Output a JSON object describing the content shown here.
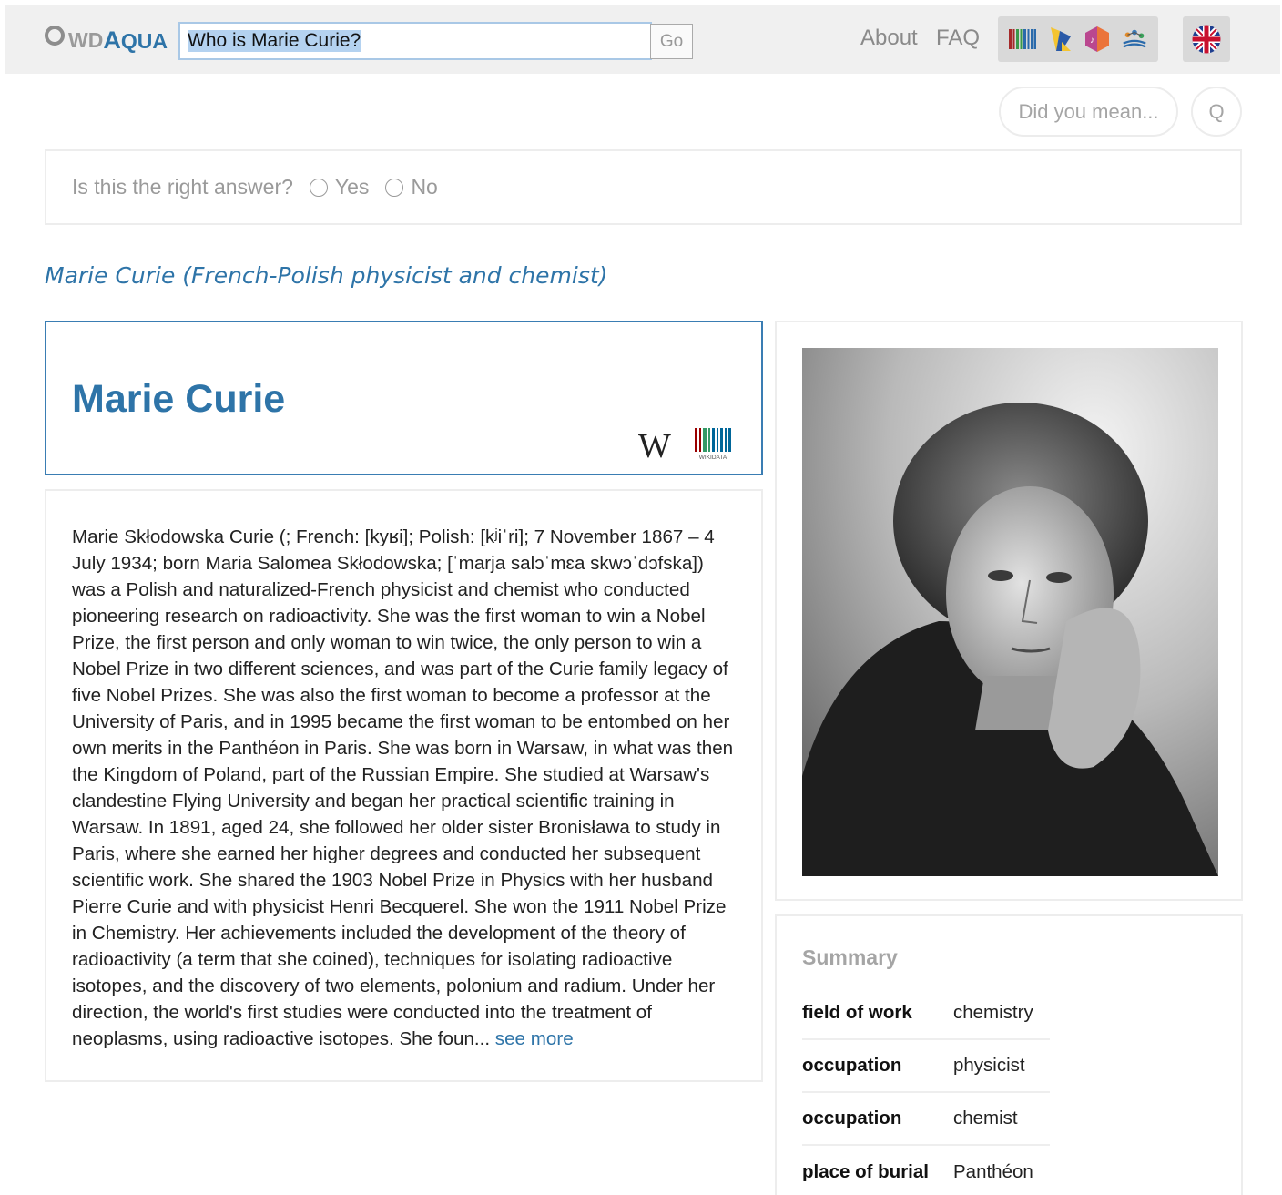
{
  "header": {
    "logo_wd": "WD",
    "logo_aqua_first": "A",
    "logo_aqua_rest": "QUA",
    "search_value": "Who is Marie Curie?",
    "go_label": "Go",
    "nav": {
      "about": "About",
      "faq": "FAQ"
    },
    "knowledge_bases": [
      "wikidata-icon",
      "dbpedia-icon",
      "musicbrainz-icon",
      "scigraph-icon"
    ],
    "language_icon": "uk-flag-icon"
  },
  "did_you_mean": {
    "label": "Did you mean...",
    "q_label": "Q"
  },
  "feedback": {
    "question": "Is this the right answer?",
    "yes": "Yes",
    "no": "No"
  },
  "entity": {
    "description": "Marie Curie (French-Polish physicist and chemist)",
    "title": "Marie Curie",
    "wikipedia_letter": "W",
    "wikidata_label": "WIKIDATA"
  },
  "abstract": {
    "text": "Marie Skłodowska Curie (; French: [kyʁi]; Polish: [kʲiˈri]; 7 November 1867 – 4 July 1934; born Maria Salomea Skłodowska; [ˈmarja salɔˈmɛa skwɔˈdɔfska]) was a Polish and naturalized-French physicist and chemist who conducted pioneering research on radioactivity. She was the first woman to win a Nobel Prize, the first person and only woman to win twice, the only person to win a Nobel Prize in two different sciences, and was part of the Curie family legacy of five Nobel Prizes. She was also the first woman to become a professor at the University of Paris, and in 1995 became the first woman to be entombed on her own merits in the Panthéon in Paris. She was born in Warsaw, in what was then the Kingdom of Poland, part of the Russian Empire. She studied at Warsaw's clandestine Flying University and began her practical scientific training in Warsaw. In 1891, aged 24, she followed her older sister Bronisława to study in Paris, where she earned her higher degrees and conducted her subsequent scientific work. She shared the 1903 Nobel Prize in Physics with her husband Pierre Curie and with physicist Henri Becquerel. She won the 1911 Nobel Prize in Chemistry. Her achievements included the development of the theory of radioactivity (a term that she coined), techniques for isolating radioactive isotopes, and the discovery of two elements, polonium and radium. Under her direction, the world's first studies were conducted into the treatment of neoplasms, using radioactive isotopes. She foun...",
    "see_more": "see more"
  },
  "summary": {
    "title": "Summary",
    "rows": [
      {
        "key": "field of work",
        "value": "chemistry"
      },
      {
        "key": "occupation",
        "value": "physicist"
      },
      {
        "key": "occupation",
        "value": "chemist"
      },
      {
        "key": "place of burial",
        "value": "Panthéon"
      }
    ]
  },
  "colors": {
    "brand_blue": "#2e74a8",
    "topbar_bg": "#f0f0f0",
    "muted_text": "#9a9a9a"
  }
}
